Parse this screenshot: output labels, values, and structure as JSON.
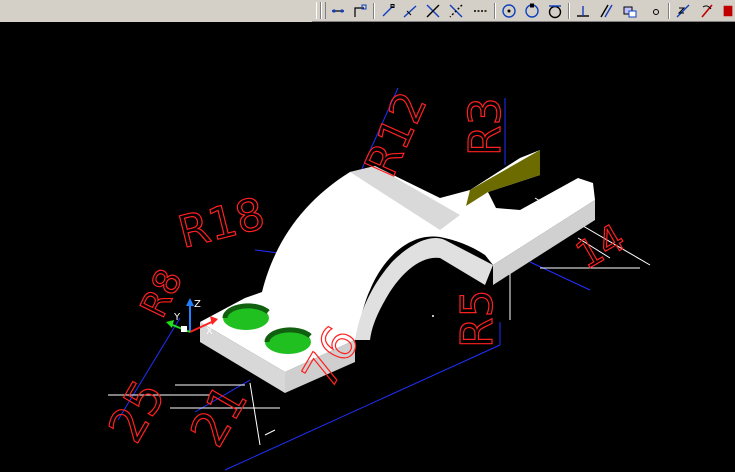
{
  "toolbar": {
    "buttons": [
      {
        "icon": "linear-dimension-icon"
      },
      {
        "icon": "ordinate-dimension-icon"
      },
      {
        "icon": "line-icon"
      },
      {
        "icon": "aligned-line-icon"
      },
      {
        "icon": "intersection-snap-icon"
      },
      {
        "icon": "apparent-intersection-snap-icon"
      },
      {
        "icon": "dashed-line-icon"
      },
      {
        "icon": "center-snap-icon"
      },
      {
        "icon": "quadrant-snap-icon"
      },
      {
        "icon": "tangent-snap-icon"
      },
      {
        "icon": "perpendicular-snap-icon"
      },
      {
        "icon": "parallel-snap-icon"
      },
      {
        "icon": "insert-snap-icon"
      },
      {
        "icon": "node-snap-icon"
      },
      {
        "icon": "nearest-snap-icon"
      },
      {
        "icon": "snap-none-icon"
      }
    ]
  },
  "drawing": {
    "dimensions": {
      "r12": "R12",
      "r3": "R3",
      "r18": "R18",
      "r8": "R8",
      "r5": "R5",
      "d14": "14",
      "d76": "76",
      "d25": "25",
      "d21": "21"
    },
    "ucs": {
      "x": "X",
      "y": "Y",
      "z": "Z"
    },
    "colors": {
      "background": "#000000",
      "dimension": "#ff2020",
      "extension": "#2030ff",
      "witness": "#ffffff",
      "part_face": "#ffffff",
      "part_side": "#d8d8d8",
      "hole": "#20c020",
      "slot_face": "#6b6b00"
    }
  }
}
